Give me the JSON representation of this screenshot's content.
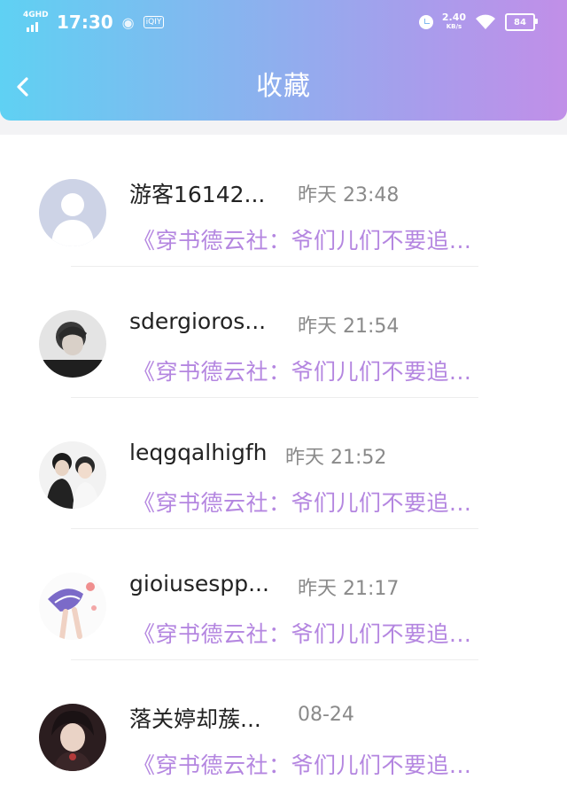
{
  "status_bar": {
    "network": "4GHD",
    "time": "17:30",
    "speed_value": "2.40",
    "speed_unit": "KB/s",
    "battery": "84"
  },
  "header": {
    "title": "收藏"
  },
  "colors": {
    "gradient_start": "#5fd1f3",
    "gradient_end": "#c18fe8",
    "preview_text": "#b486e0",
    "time_text": "#8a8a8a"
  },
  "items": [
    {
      "name": "游客16142...",
      "time": "昨天 23:48",
      "preview": "《穿书德云社：爷们儿们不要追..."
    },
    {
      "name": "sdergioros...",
      "time": "昨天 21:54",
      "preview": "《穿书德云社：爷们儿们不要追..."
    },
    {
      "name": "leqgqalhigfh",
      "time": "昨天 21:52",
      "preview": "《穿书德云社：爷们儿们不要追..."
    },
    {
      "name": "gioiusespp...",
      "time": "昨天 21:17",
      "preview": "《穿书德云社：爷们儿们不要追..."
    },
    {
      "name": "落关婷却蔟...",
      "time": "08-24",
      "preview": "《穿书德云社：爷们儿们不要追..."
    }
  ]
}
